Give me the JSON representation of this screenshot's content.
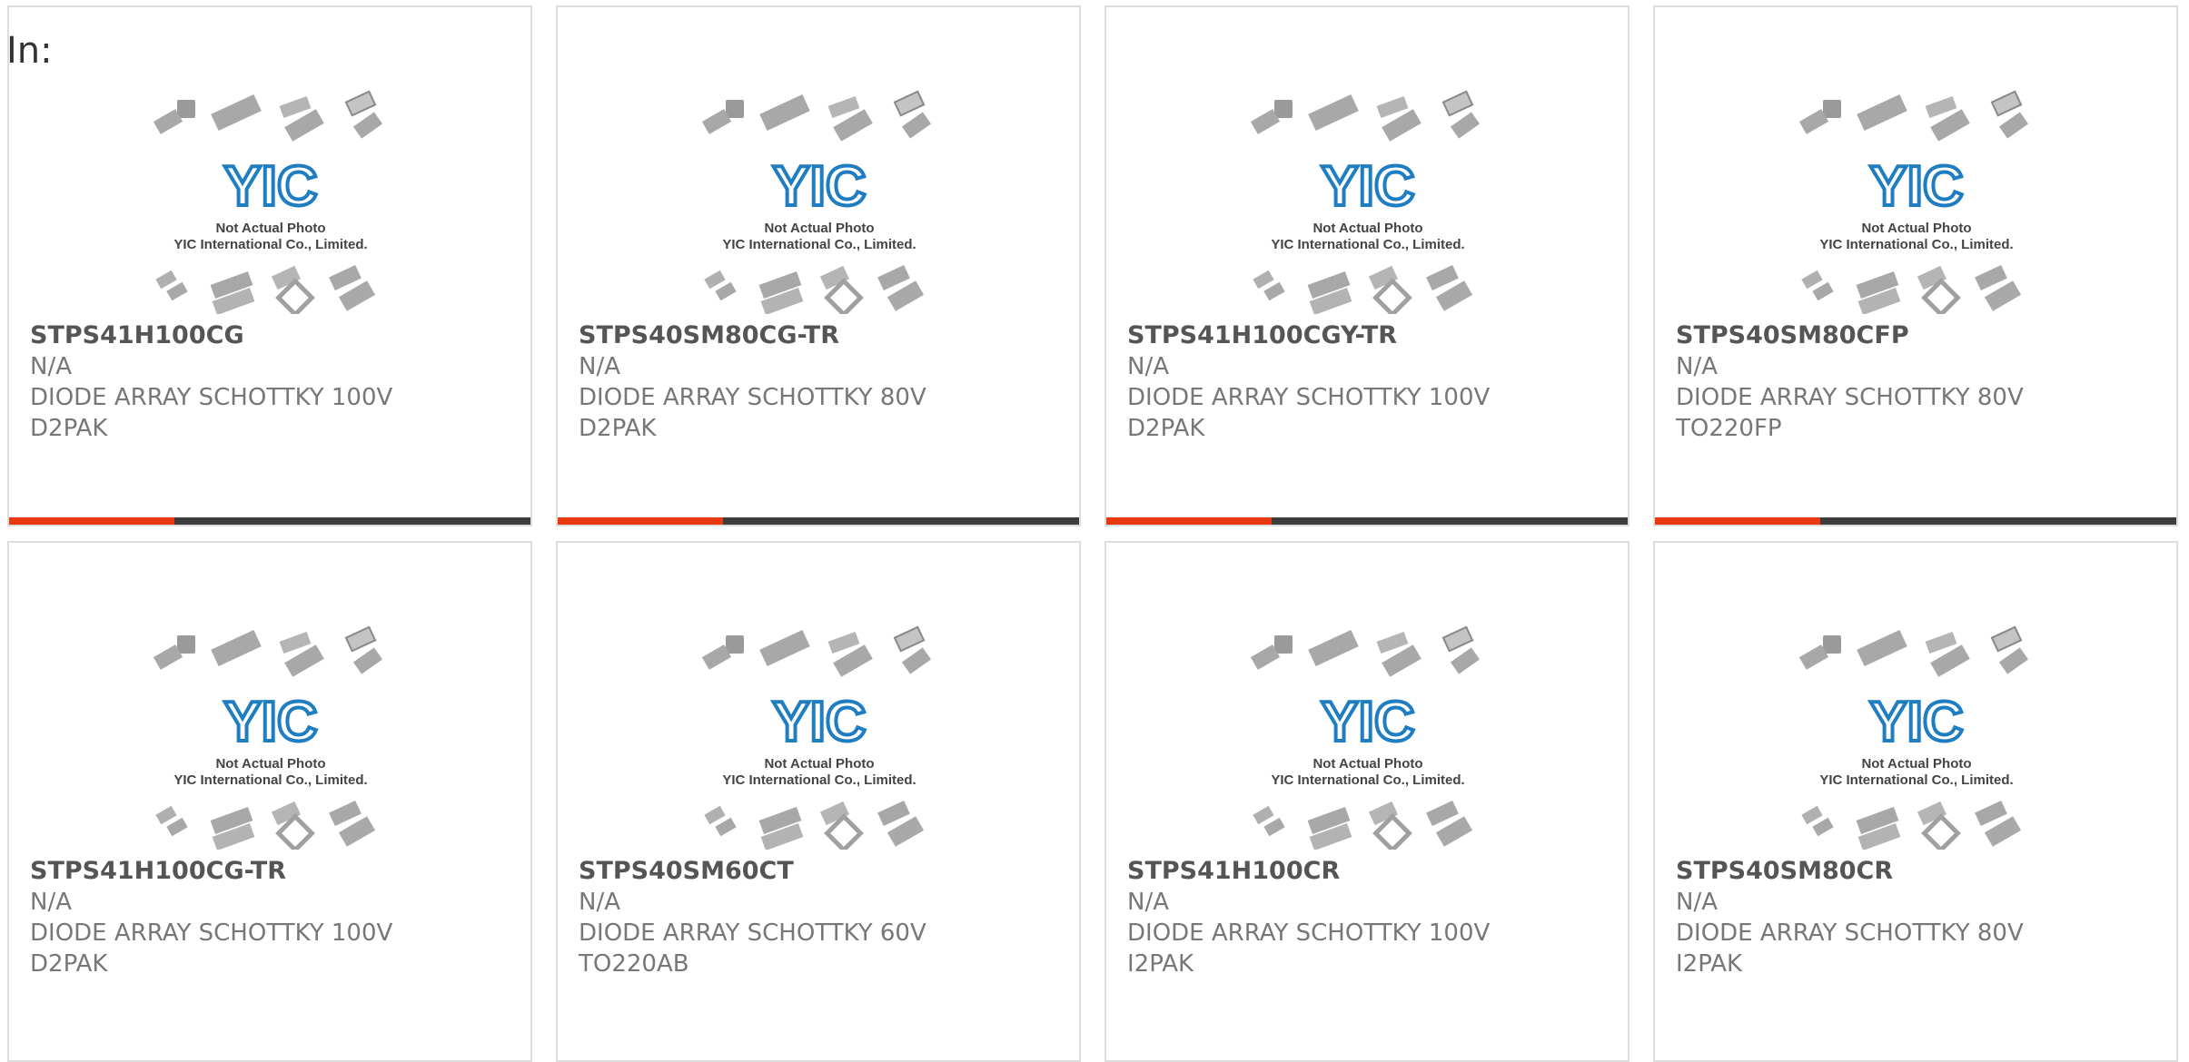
{
  "header": {
    "label": "In:"
  },
  "placeholder": {
    "brand": "YIC",
    "caption1": "Not Actual Photo",
    "caption2": "YIC International Co., Limited."
  },
  "colors": {
    "accent": "#e8380f",
    "bar": "#3d3d3d",
    "brand_blue": "#1f7dc2",
    "chip_gray": "#a8a8a8"
  },
  "products": [
    {
      "part": "STPS41H100CG",
      "stock": "N/A",
      "description": "DIODE ARRAY SCHOTTKY 100V",
      "package": "D2PAK"
    },
    {
      "part": "STPS40SM80CG-TR",
      "stock": "N/A",
      "description": "DIODE ARRAY SCHOTTKY 80V",
      "package": "D2PAK"
    },
    {
      "part": "STPS41H100CGY-TR",
      "stock": "N/A",
      "description": "DIODE ARRAY SCHOTTKY 100V",
      "package": "D2PAK"
    },
    {
      "part": "STPS40SM80CFP",
      "stock": "N/A",
      "description": "DIODE ARRAY SCHOTTKY 80V",
      "package": "TO220FP"
    },
    {
      "part": "STPS41H100CG-TR",
      "stock": "N/A",
      "description": "DIODE ARRAY SCHOTTKY 100V",
      "package": "D2PAK"
    },
    {
      "part": "STPS40SM60CT",
      "stock": "N/A",
      "description": "DIODE ARRAY SCHOTTKY 60V",
      "package": "TO220AB"
    },
    {
      "part": "STPS41H100CR",
      "stock": "N/A",
      "description": "DIODE ARRAY SCHOTTKY 100V",
      "package": "I2PAK"
    },
    {
      "part": "STPS40SM80CR",
      "stock": "N/A",
      "description": "DIODE ARRAY SCHOTTKY 80V",
      "package": "I2PAK"
    }
  ]
}
